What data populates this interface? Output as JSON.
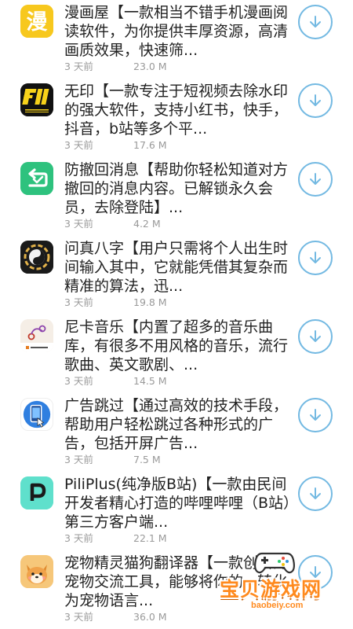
{
  "colors": {
    "accent": "#73b9e2",
    "meta_text": "#9a9a9a",
    "watermark": "#ff8a1e"
  },
  "apps": [
    {
      "icon": "manhua-house-icon",
      "description": "漫画屋【一款相当不错手机漫画阅读软件，为你提供丰厚资源，高清画质效果，快速筛...",
      "date": "3 天前",
      "size": "23.0 M"
    },
    {
      "icon": "wuyin-watermark-remover-icon",
      "description": "无印【一款专注于短视频去除水印的强大软件，支持小红书，快手，抖音，b站等多个平...",
      "date": "3 天前",
      "size": "17.6 M"
    },
    {
      "icon": "anti-recall-icon",
      "description": "防撤回消息【帮助你轻松知道对方撤回的消息内容。已解锁永久会员，去除登陆】...",
      "date": "3 天前",
      "size": "4.2 M"
    },
    {
      "icon": "bagua-icon",
      "description": "问真八字【用户只需将个人出生时间输入其中，它就能凭借其复杂而精准的算法，迅...",
      "date": "3 天前",
      "size": "19.8 M"
    },
    {
      "icon": "nika-music-icon",
      "description": "尼卡音乐【内置了超多的音乐曲库，有很多不用风格的音乐，流行歌曲、英文歌剧、...",
      "date": "3 天前",
      "size": "14.5 M"
    },
    {
      "icon": "ad-skip-icon",
      "description": "广告跳过【通过高效的技术手段，帮助用户轻松跳过各种形式的广告，包括开屏广告...",
      "date": "3 天前",
      "size": "7.5 M"
    },
    {
      "icon": "pilipilus-icon",
      "description": "PiliPlus(纯净版B站)【一款由民间开发者精心打造的哔哩哔哩（B站）第三方客户端...",
      "date": "3 天前",
      "size": "22.1 M"
    },
    {
      "icon": "pet-translator-icon",
      "description": "宠物精灵猫狗翻译器【一款创新的宠物交流工具，能够将你的...转化为宠物语言...",
      "date": "3 天前",
      "size": "36.0 M"
    }
  ],
  "watermark": {
    "text": "宝贝游戏网",
    "url": "baobeiy.com"
  }
}
